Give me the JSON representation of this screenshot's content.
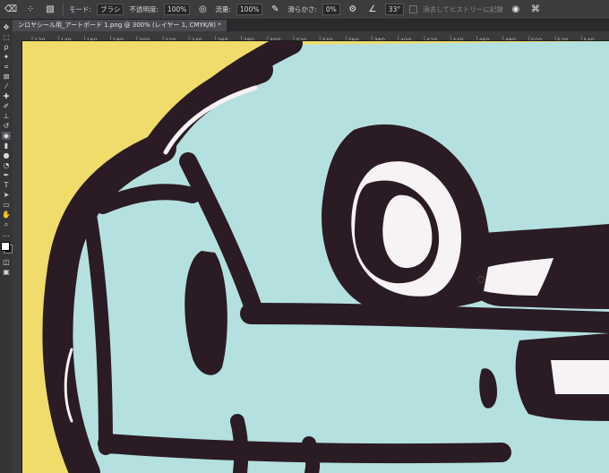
{
  "options_bar": {
    "mode_label": "モード:",
    "mode_value": "ブラシ",
    "opacity_label": "不透明度:",
    "opacity_value": "100%",
    "flow_label": "流量:",
    "flow_value": "100%",
    "smoothing_label": "滑らかさ:",
    "smoothing_value": "0%",
    "angle_value": "33°",
    "history_label": "消去してヒストリーに記録"
  },
  "document_tab": {
    "title": "ンロヤシール用_アートボード 1.png @ 300% (レイヤー 1, CMYK/8) *"
  },
  "ruler": {
    "marks": [
      "120",
      "140",
      "160",
      "180",
      "200",
      "220",
      "240",
      "260",
      "280",
      "300",
      "320",
      "340",
      "360",
      "380",
      "400",
      "420",
      "440",
      "460",
      "480",
      "500",
      "520",
      "540"
    ]
  },
  "toolbar": {
    "tools": [
      "move-icon",
      "marquee-icon",
      "lasso-icon",
      "magic-wand-icon",
      "crop-icon",
      "frame-icon",
      "eyedropper-icon",
      "healing-icon",
      "brush-icon",
      "stamp-icon",
      "history-brush-icon",
      "eraser-icon",
      "gradient-icon",
      "blur-icon",
      "dodge-icon",
      "pen-icon",
      "type-icon",
      "path-select-icon",
      "shape-icon",
      "hand-icon",
      "zoom-icon",
      "more-icon"
    ],
    "foreground_color": "#ffffff",
    "background_color": "#1d1d1d"
  },
  "colors": {
    "canvas_yellow": "#f0dc6a",
    "canvas_blue": "#b5e0e0",
    "outline": "#2a1b24",
    "white": "#f7f2f4"
  }
}
